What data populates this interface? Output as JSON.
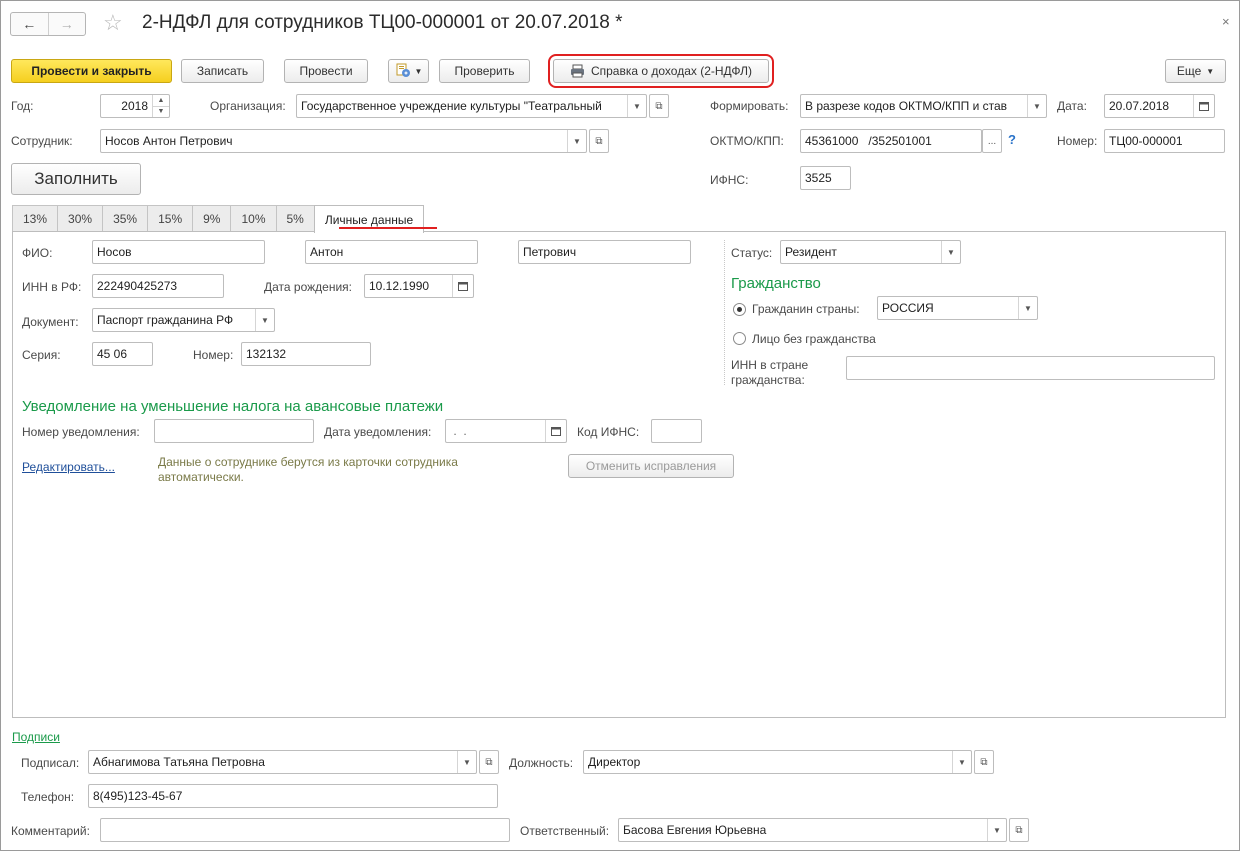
{
  "window": {
    "title": "2-НДФЛ для сотрудников ТЦ00-000001 от 20.07.2018 *",
    "back": "←",
    "forward": "→",
    "favorite": "☆",
    "close": "×"
  },
  "toolbar": {
    "post_and_close": "Провести и закрыть",
    "save": "Записать",
    "post": "Провести",
    "check": "Проверить",
    "income_report": "Справка о доходах (2-НДФЛ)",
    "more": "Еще"
  },
  "header": {
    "year_label": "Год:",
    "year_value": "2018",
    "org_label": "Организация:",
    "org_value": "Государственное учреждение культуры \"Театральный",
    "form_label": "Формировать:",
    "form_value": "В разрезе кодов ОКТМО/КПП и став",
    "date_label": "Дата:",
    "date_value": "20.07.2018",
    "employee_label": "Сотрудник:",
    "employee_value": "Носов Антон Петрович",
    "oktmo_label": "ОКТМО/КПП:",
    "oktmo_value": "45361000   /352501001",
    "oktmo_select": "...",
    "oktmo_help": "?",
    "number_label": "Номер:",
    "number_value": "ТЦ00-000001",
    "fill_button": "Заполнить",
    "ifns_label": "ИФНС:",
    "ifns_value": "3525"
  },
  "tabs": [
    "13%",
    "30%",
    "35%",
    "15%",
    "9%",
    "10%",
    "5%",
    "Личные данные"
  ],
  "personal": {
    "fio_label": "ФИО:",
    "last_name": "Носов",
    "first_name": "Антон",
    "middle_name": "Петрович",
    "inn_label": "ИНН в РФ:",
    "inn_value": "222490425273",
    "birth_label": "Дата рождения:",
    "birth_value": "10.12.1990",
    "doc_label": "Документ:",
    "doc_value": "Паспорт гражданина РФ",
    "series_label": "Серия:",
    "series_value": "45 06",
    "docnum_label": "Номер:",
    "docnum_value": "132132",
    "status_label": "Статус:",
    "status_value": "Резидент",
    "citizenship_title": "Гражданство",
    "citizen_label": "Гражданин страны:",
    "citizen_value": "РОССИЯ",
    "stateless_label": "Лицо без гражданства",
    "inn_foreign_label_1": "ИНН в стране",
    "inn_foreign_label_2": "гражданства:",
    "notice_title": "Уведомление на уменьшение налога на авансовые платежи",
    "notice_num_label": "Номер уведомления:",
    "notice_date_label": "Дата уведомления:",
    "notice_date_value": " .  .",
    "ifns_code_label": "Код ИФНС:",
    "edit_link": "Редактировать",
    "edit_dots": "...",
    "info_line_1": "Данные о сотруднике берутся из карточки сотрудника",
    "info_line_2": "автоматически.",
    "cancel_fixes": "Отменить исправления"
  },
  "signatures": {
    "section_link": "Подписи",
    "signed_label": "Подписал:",
    "signed_value": "Абнагимова Татьяна Петровна",
    "position_label": "Должность:",
    "position_value": "Директор",
    "phone_label": "Телефон:",
    "phone_value": "8(495)123-45-67",
    "comment_label": "Комментарий:",
    "responsible_label": "Ответственный:",
    "responsible_value": "Басова Евгения Юрьевна"
  },
  "colors": {
    "primary_button": "#f5cf1f",
    "section_green": "#1a9a4a",
    "highlight_red": "#e02020",
    "link_blue": "#1f4f9a"
  }
}
